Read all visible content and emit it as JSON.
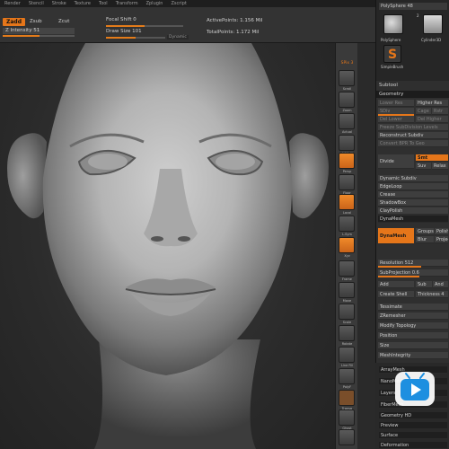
{
  "menubar": [
    "Render",
    "Stencil",
    "Stroke",
    "Texture",
    "Tool",
    "Transform",
    "Zplugin",
    "Zscript"
  ],
  "toolbar": {
    "zadd": "Zadd",
    "zsub": "Zsub",
    "zcut": "Zcut",
    "z_intensity": "Z Intensity 51",
    "focal_shift": "Focal Shift 0",
    "draw_size": "Draw Size 101",
    "dynamic": "Dynamic",
    "active_points": "ActivePoints: 1.156 Mil",
    "total_points": "TotalPoints: 1.172 Mil",
    "z_intensity_value": 51,
    "draw_size_value": 101
  },
  "shelf": {
    "top_label": "SPix 3",
    "labels": [
      "Scroll",
      "Zoom",
      "Actual",
      "AAHalf",
      "Persp",
      "Floor",
      "Local",
      "L.Sym",
      "Xyz",
      "Frame",
      "Move",
      "Scale",
      "Rotate",
      "Line Fill",
      "PolyF",
      "Transp",
      "Ghost",
      "Solo",
      "Xpose"
    ]
  },
  "rightpanel": {
    "polysphere_slider": "PolySphere  48",
    "thumb_number": "2",
    "thumbs": [
      "PolySphere",
      "Cylinder3D",
      "SimpleBrush"
    ],
    "subtool": "Subtool",
    "geometry": "Geometry",
    "lower_res": "Lower Res",
    "higher_res": "Higher Res",
    "sdiv": "SDiv",
    "cage": "Cage",
    "rstr": "Rstr",
    "del_lower": "Del Lower",
    "del_higher": "Del Higher",
    "freeze": "Freeze SubDivision Levels",
    "reconstruct": "Reconstruct Subdiv",
    "convert_bpr": "Convert BPR To Geo",
    "divide": "Divide",
    "smt": "Smt",
    "suv": "Suv",
    "relax": "Relax",
    "dynamic_subdiv": "Dynamic Subdiv",
    "edgeloop": "EdgeLoop",
    "crease": "Crease",
    "shadowbox": "ShadowBox",
    "claypolish": "ClayPolish",
    "dynamesh_head": "DynaMesh",
    "dynamesh_btn": "DynaMesh",
    "groups": "Groups",
    "polish": "Polish",
    "blur": "Blur",
    "project": "Project",
    "resolution": "Resolution 512",
    "subprojection": "SubProjection 0.6",
    "add": "Add",
    "sub": "Sub",
    "and": "And",
    "create_shell": "Create Shell",
    "thickness": "Thickness 4",
    "tessimate": "Tessimate",
    "zremesher": "ZRemesher",
    "modify_topology": "Modify Topology",
    "position": "Position",
    "size": "Size",
    "meshintegrity": "MeshIntegrity",
    "arraymesh": "ArrayMesh",
    "nanomesh": "NanoMesh",
    "layers": "Layers",
    "fibermesh": "FiberMesh",
    "geometry_hd": "Geometry HD",
    "preview": "Preview",
    "surface": "Surface",
    "deformation": "Deformation"
  },
  "colors": {
    "accent": "#e5761a",
    "panel": "#2f2f2f",
    "viewport": "#2b2b2b"
  }
}
